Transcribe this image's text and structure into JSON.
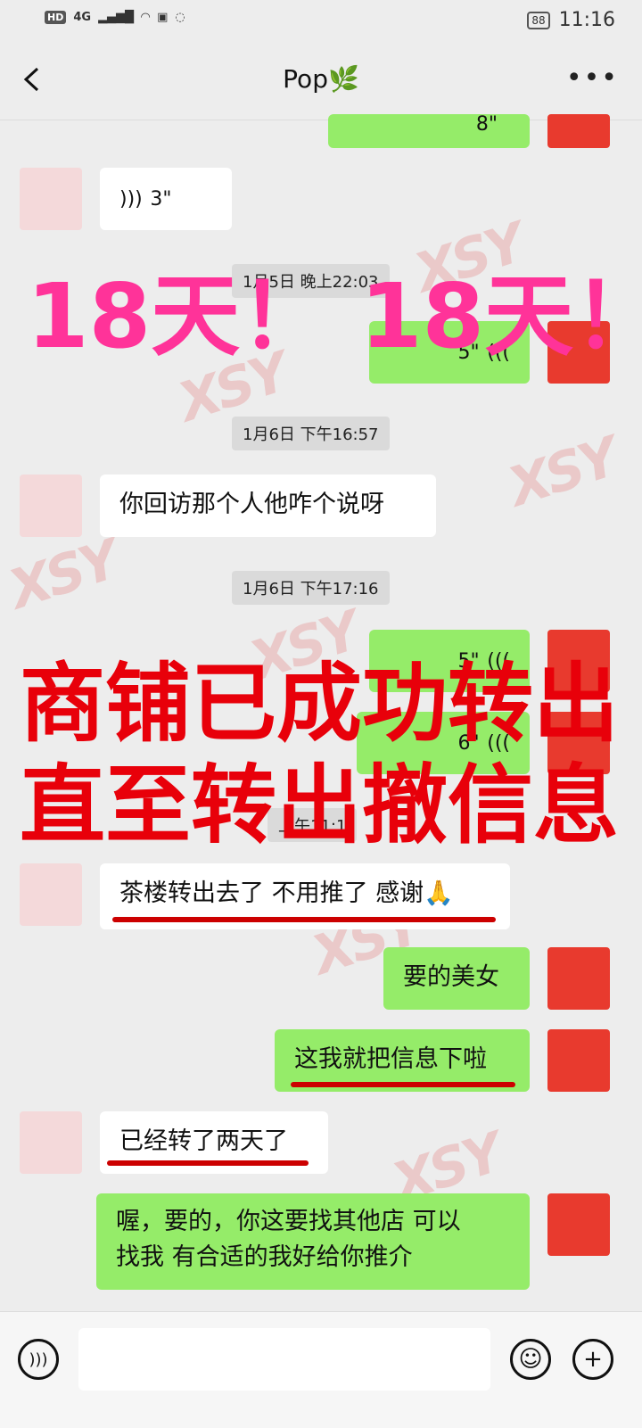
{
  "status_bar": {
    "left_labels": [
      "HD",
      "4G"
    ],
    "battery": "88",
    "time": "11:16"
  },
  "header": {
    "title": "Pop🌿"
  },
  "watermark_text": "XSY",
  "messages": {
    "voice_top": "8\"",
    "voice_3": "3\"",
    "ts1": "1月5日 晚上22:03",
    "voice_5a": "5\"",
    "ts2": "1月6日 下午16:57",
    "msg_1": "你回访那个人他咋个说呀",
    "ts3": "1月6日 下午17:16",
    "voice_5b": "5\"",
    "voice_6": "6\"",
    "ts4": "上午11:1",
    "msg_2": "茶楼转出去了 不用推了 感谢🙏",
    "msg_3": "要的美女",
    "msg_4": "这我就把信息下啦",
    "msg_5": "已经转了两天了",
    "msg_6_line1": "喔，要的，你这要找其他店 可以",
    "msg_6_line2": "找我 有合适的我好给你推介"
  },
  "overlays": {
    "top_text": "18天！ 18天！",
    "main_line1": "商铺已成功转出",
    "main_line2": "直至转出撤信息"
  },
  "colors": {
    "me_bubble": "#95ec69",
    "her_bubble": "#ffffff",
    "overlay_pink": "#ff3399",
    "overlay_red": "#e8000a",
    "background": "#ededed"
  }
}
